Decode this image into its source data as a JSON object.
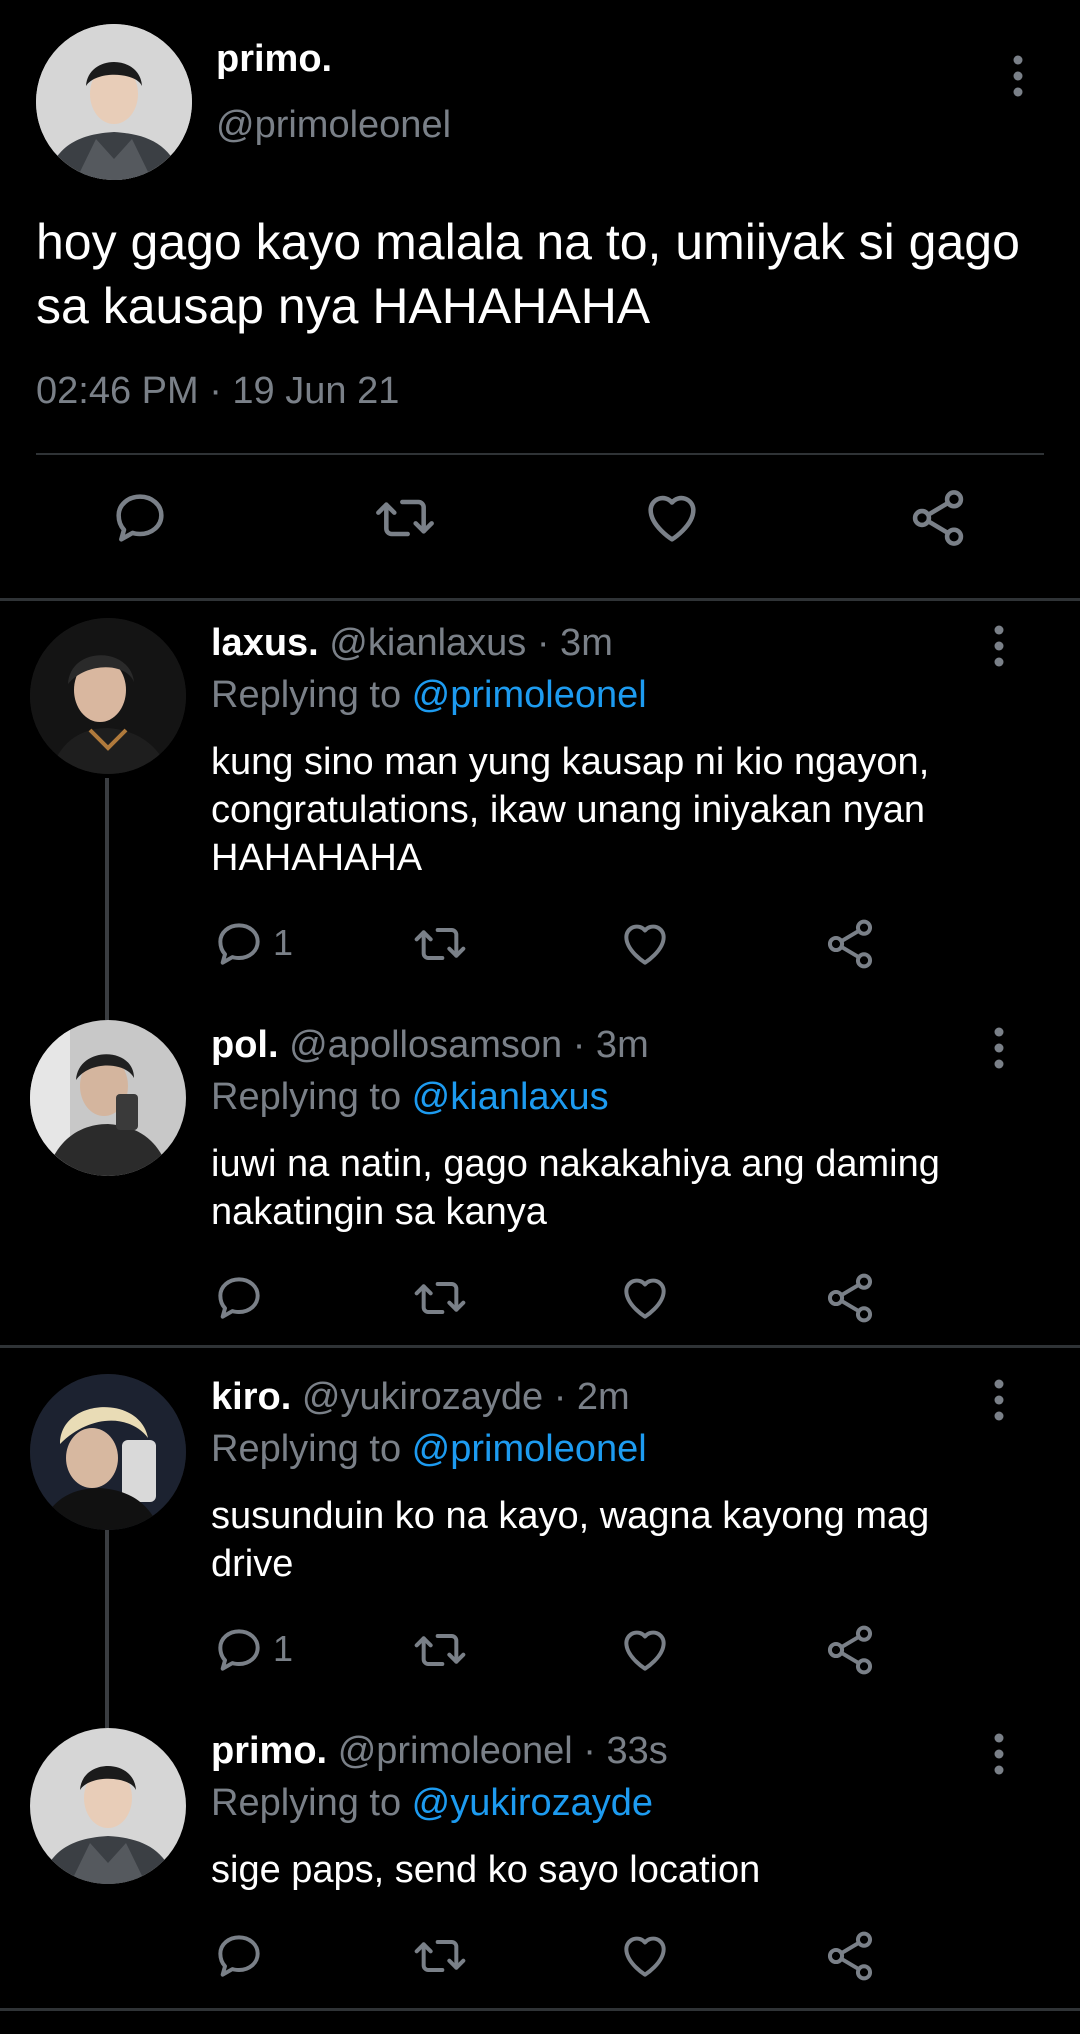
{
  "colors": {
    "background": "#000000",
    "text": "#ffffff",
    "muted": "#7a8088",
    "link": "#1d9bf0",
    "divider": "#2f3336"
  },
  "main_tweet": {
    "name": "primo.",
    "handle": "@primoleonel",
    "text": "hoy gago kayo malala na to, umiiyak si gago sa kausap nya HAHAHAHA",
    "timestamp": "02:46 PM · 19 Jun 21",
    "icons": [
      "reply-icon",
      "retweet-icon",
      "like-icon",
      "share-icon",
      "more-icon"
    ]
  },
  "replies": [
    {
      "name": "laxus.",
      "meta": "@kianlaxus · 3m",
      "replying_prefix": "Replying to ",
      "replying_to": "@primoleonel",
      "text": "kung sino man yung kausap ni kio ngayon, congratulations, ikaw unang iniyakan nyan HAHAHAHA",
      "reply_count": "1"
    },
    {
      "name": "pol.",
      "meta": "@apollosamson · 3m",
      "replying_prefix": "Replying to ",
      "replying_to": "@kianlaxus",
      "text": "iuwi na natin, gago nakakahiya ang daming nakatingin sa kanya",
      "reply_count": ""
    },
    {
      "name": "kiro.",
      "meta": "@yukirozayde · 2m",
      "replying_prefix": "Replying to ",
      "replying_to": "@primoleonel",
      "text": "susunduin ko na kayo, wagna kayong mag drive",
      "reply_count": "1"
    },
    {
      "name": "primo.",
      "meta": "@primoleonel · 33s",
      "replying_prefix": "Replying to ",
      "replying_to": "@yukirozayde",
      "text": "sige paps, send ko sayo location",
      "reply_count": ""
    }
  ]
}
